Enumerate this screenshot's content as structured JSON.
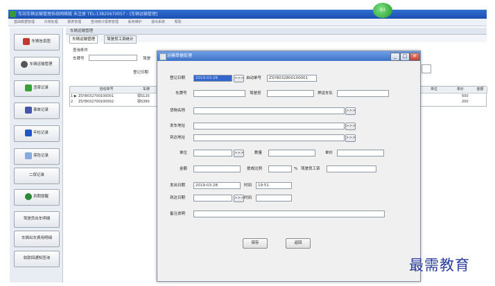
{
  "app": {
    "title": "车站车辆运输管理系统网络版 未注册 TEL:13825670057 - [车辆运输管理]",
    "bubble": "63"
  },
  "menu": [
    "基础数据管理",
    "日常处理",
    "报表管理",
    "查询统计报表管理",
    "系统维护",
    "退出系统",
    "帮助"
  ],
  "sidebar": {
    "items": [
      {
        "label": "车辆信息图",
        "icon": "truck-icon",
        "color": "#c0392b"
      },
      {
        "label": "车辆运输管理",
        "icon": "wheel-icon",
        "color": "#555555"
      },
      {
        "label": "违章记录",
        "icon": "ticket-icon",
        "color": "#3aa13a"
      },
      {
        "label": "事故记录",
        "icon": "car-crash-icon",
        "color": "#4455aa"
      },
      {
        "label": "年检记录",
        "icon": "inspection-icon",
        "color": "#2255cc"
      },
      {
        "label": "保险记录",
        "icon": "insurance-icon",
        "color": "#88aadd"
      },
      {
        "label": "二保记录",
        "icon": "",
        "color": ""
      },
      {
        "label": "到期提醒",
        "icon": "alarm-icon",
        "color": "#2a8a3a"
      },
      {
        "label": "驾驶员出车明细",
        "icon": "",
        "color": ""
      },
      {
        "label": "车辆出车费用明细",
        "icon": "",
        "color": ""
      },
      {
        "label": "收款回通知查询",
        "icon": "",
        "color": ""
      }
    ]
  },
  "background_window": {
    "title": "车辆运输管理",
    "tabs": [
      "车辆运输管理",
      "驾驶员工资统计"
    ],
    "query_label": "查询条件",
    "plate_label": "车牌号",
    "driver_label": "驾驶",
    "date_label": "登记日期",
    "grid": {
      "headers": [
        "自动单号",
        "车牌",
        "单位",
        "单价",
        "金额"
      ],
      "rows": [
        {
          "marker": "1 ▶",
          "id": "ZSY8032700100001",
          "plate": "鄂S120",
          "price": "500"
        },
        {
          "marker": "2",
          "id": "ZSY8032700100002",
          "plate": "鄂S360",
          "price": "200"
        }
      ]
    }
  },
  "dialog": {
    "title": "运输单据处理",
    "fields": {
      "reg_date": {
        "label": "登记日期",
        "value": "2019-03-28"
      },
      "auto_no": {
        "label": "自动单号",
        "value": "ZSY8032800100001"
      },
      "plate": {
        "label": "车牌号",
        "value": ""
      },
      "driver": {
        "label": "驾驶员",
        "value": ""
      },
      "escort": {
        "label": "押运车队",
        "value": ""
      },
      "goods": {
        "label": "货物名称",
        "value": ""
      },
      "ship_addr": {
        "label": "发车地址",
        "value": ""
      },
      "dest_addr": {
        "label": "到达地址",
        "value": ""
      },
      "unit": {
        "label": "单位",
        "value": ""
      },
      "qty": {
        "label": "数量",
        "value": ""
      },
      "price": {
        "label": "单价",
        "value": ""
      },
      "amount": {
        "label": "金额",
        "value": ""
      },
      "ratio": {
        "label": "提成比例",
        "value": ""
      },
      "percent": {
        "label": "%",
        "value": ""
      },
      "wage": {
        "label": "驾驶员工资",
        "value": ""
      },
      "depart_date": {
        "label": "发出日期",
        "value": "2019-03-28"
      },
      "depart_time": {
        "label": "时间",
        "value": "19:51"
      },
      "arrive_date": {
        "label": "到达日期",
        "value": ""
      },
      "arrive_time": {
        "label": "时间",
        "value": ""
      },
      "remark": {
        "label": "备注说明",
        "value": ""
      }
    },
    "browse_label": ">>>",
    "save": "保存",
    "back": "返回",
    "win_min": "_",
    "win_max": "□",
    "win_close": "✕"
  },
  "watermark": "最需教育"
}
